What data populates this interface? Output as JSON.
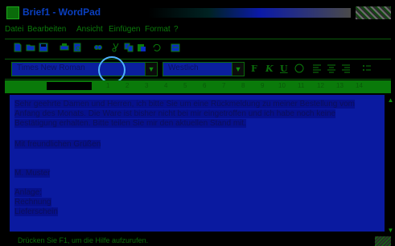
{
  "window": {
    "title": "Brief1 - WordPad"
  },
  "menubar": {
    "items": [
      "Datei",
      "Bearbeiten",
      "Ansicht",
      "Einfügen",
      "Format",
      "?"
    ]
  },
  "toolbar": {
    "icons": [
      "new-icon",
      "open-icon",
      "save-icon",
      "print-icon",
      "print-preview-icon",
      "find-icon",
      "cut-icon",
      "copy-icon",
      "paste-icon",
      "undo-icon",
      "date-time-icon"
    ]
  },
  "format_bar": {
    "font_name": "Times New Roman",
    "script": "Westlich",
    "buttons": [
      "F",
      "K",
      "U"
    ]
  },
  "ruler": {
    "labels": [
      "1",
      "2",
      "3",
      "4",
      "5",
      "6",
      "7",
      "8",
      "9",
      "10",
      "11",
      "12",
      "13",
      "14"
    ]
  },
  "document": {
    "lines": [
      "Sehr geehrte Damen und Herren, ich bitte Sie um eine Rückmeldung zu meiner Bestellung vom",
      "Anfang des Monats. Die Ware ist bisher nicht bei mir eingetroffen und ich habe noch keine",
      "Bestätigung erhalten. Bitte teilen Sie mir den aktuellen Stand mit.",
      "",
      "Mit freundlichen Grüßen",
      "",
      "",
      "M. Muster",
      "",
      "Anlage:",
      "Rechnung",
      "Lieferschein"
    ]
  },
  "statusbar": {
    "text": "Drücken Sie F1, um die Hilfe aufzurufen."
  },
  "colors": {
    "document_bg": "#0a1aa0",
    "accent_green": "#0b7a0b",
    "title_blue": "#0a3fbf"
  }
}
